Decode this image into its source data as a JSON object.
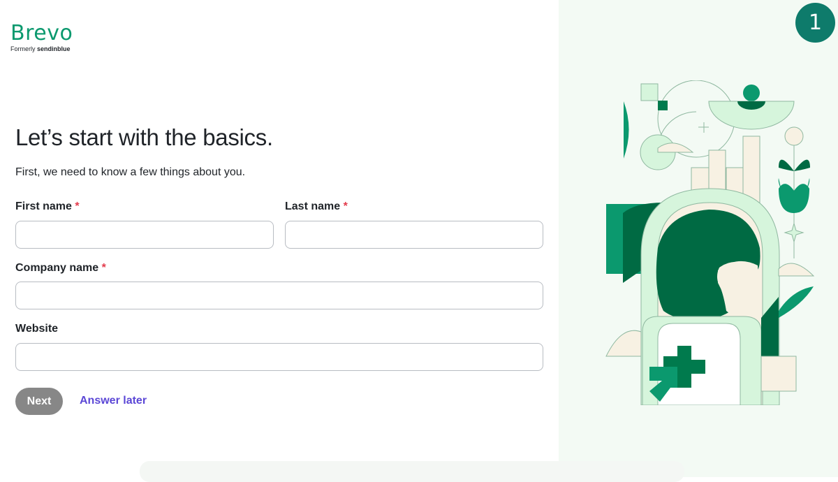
{
  "brand": {
    "name": "Brevo",
    "formerly_prefix": "Formerly",
    "formerly_name": "sendinblue",
    "color": "#0b996e"
  },
  "step": {
    "number": "1"
  },
  "form": {
    "heading": "Let’s start with the basics.",
    "subheading": "First, we need to know a few things about you.",
    "required_marker": "*",
    "fields": {
      "first_name": {
        "label": "First name",
        "value": "",
        "required": true
      },
      "last_name": {
        "label": "Last name",
        "value": "",
        "required": true
      },
      "company_name": {
        "label": "Company name",
        "value": "",
        "required": true
      },
      "website": {
        "label": "Website",
        "value": "",
        "required": false
      }
    },
    "next_label": "Next",
    "answer_later_label": "Answer later"
  },
  "colors": {
    "required": "#e33b4c",
    "link": "#5b47d6",
    "button_disabled": "#878787",
    "badge": "#0e7b6b",
    "illustration_dark": "#006a43",
    "illustration_mid": "#0b996e",
    "illustration_light": "#d6f5dc",
    "illustration_cream": "#f7f1e3"
  },
  "illustration": {
    "icon": "abstract-person-plants-illustration"
  }
}
